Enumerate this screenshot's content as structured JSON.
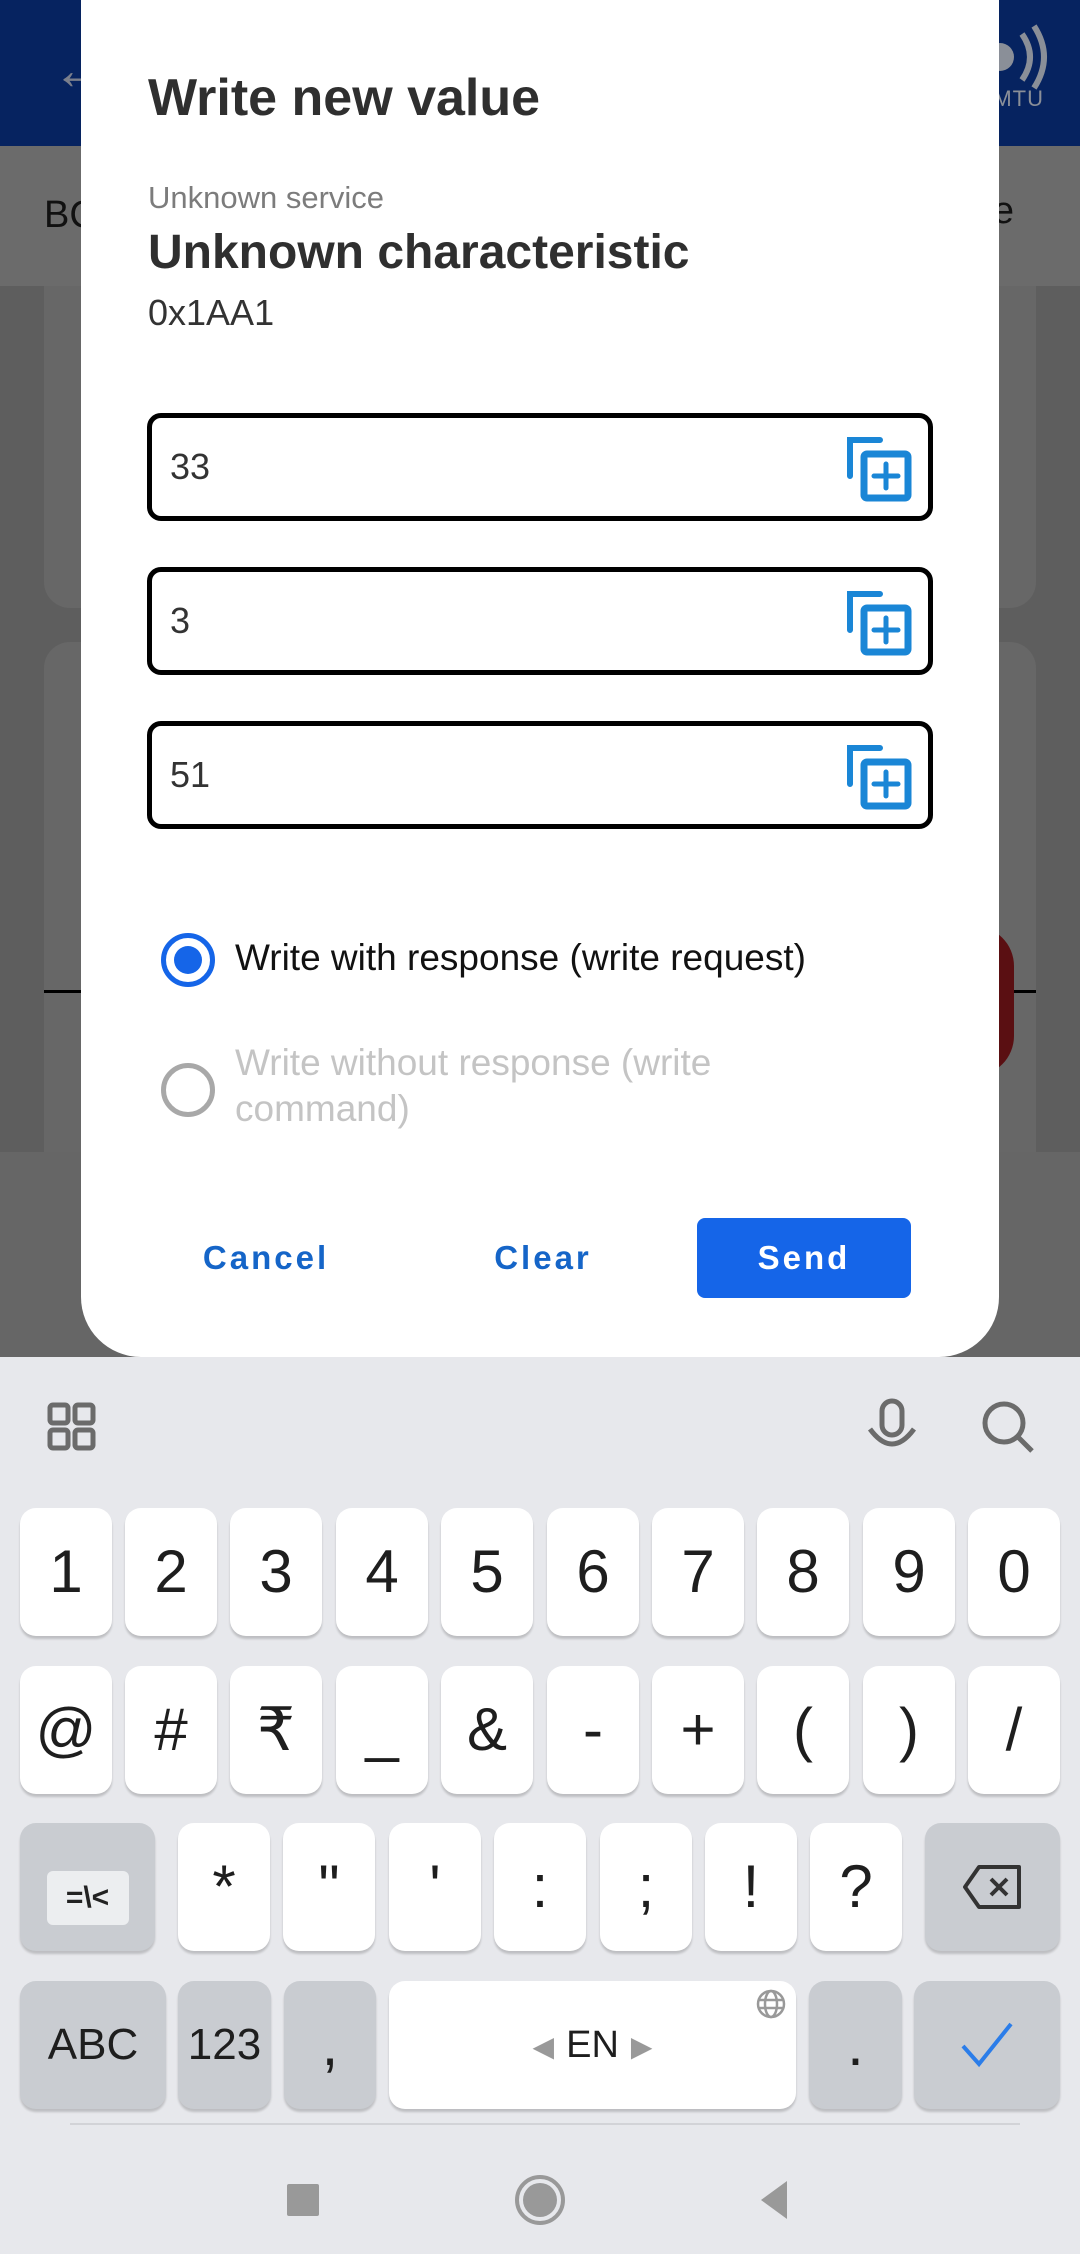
{
  "background_app": {
    "tab_left_partial": "BC",
    "tab_right_partial": "e",
    "mtu_label": "MTU",
    "colors": {
      "appbar": "#062360",
      "scrim": "#666666"
    }
  },
  "dialog": {
    "title": "Write new value",
    "service_label": "Unknown service",
    "characteristic_name": "Unknown characteristic",
    "characteristic_uuid": "0x1AA1",
    "fields": [
      {
        "value": "33",
        "action_icon": "add-to-queue-icon"
      },
      {
        "value": "3",
        "action_icon": "add-to-queue-icon"
      },
      {
        "value": "51",
        "action_icon": "add-to-queue-icon"
      }
    ],
    "write_types": [
      {
        "label": "Write with response (write request)",
        "selected": true,
        "enabled": true
      },
      {
        "label": "Write without response (write command)",
        "selected": false,
        "enabled": false
      }
    ],
    "buttons": {
      "cancel": "Cancel",
      "clear": "Clear",
      "send": "Send"
    },
    "colors": {
      "accent": "#1565E8",
      "icon": "#1A86D6"
    }
  },
  "keyboard": {
    "toolbar": {
      "left_icon": "grid-menu-icon",
      "right_icons": [
        "microphone-icon",
        "search-icon"
      ]
    },
    "row1": [
      "1",
      "2",
      "3",
      "4",
      "5",
      "6",
      "7",
      "8",
      "9",
      "0"
    ],
    "row2": [
      "@",
      "#",
      "₹",
      "_",
      "&",
      "-",
      "+",
      "(",
      ")",
      "/"
    ],
    "row3": {
      "toggle": "=\\<",
      "keys": [
        "*",
        "\"",
        "'",
        ":",
        ";",
        "!",
        "?"
      ],
      "backspace": "backspace-icon"
    },
    "row4": {
      "abc": "ABC",
      "num": "123",
      "comma": ",",
      "space_lang": "EN",
      "period": ".",
      "enter": "check-icon"
    }
  },
  "navbar": {
    "buttons": [
      "recents",
      "home",
      "back"
    ]
  }
}
